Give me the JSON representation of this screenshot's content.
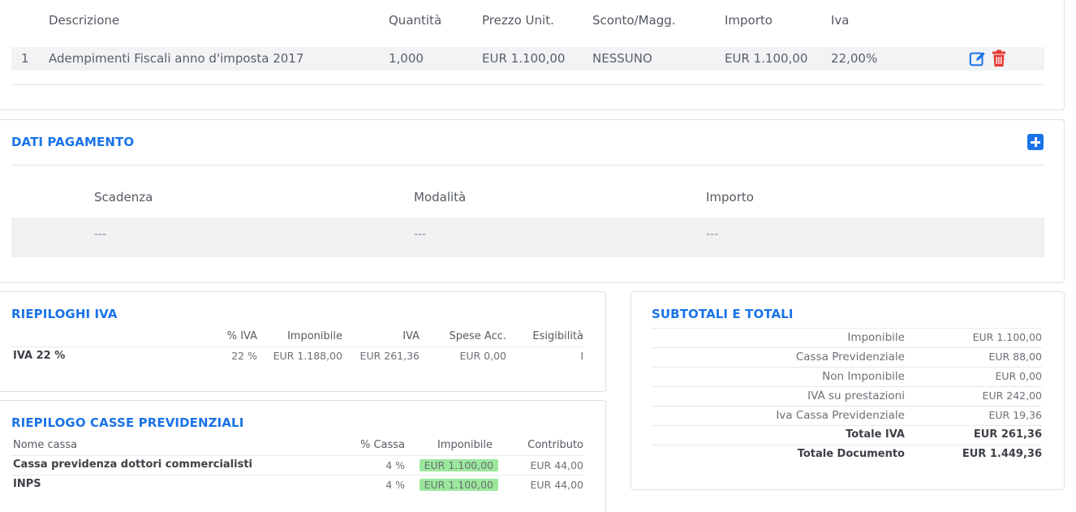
{
  "items": {
    "headers": {
      "descrizione": "Descrizione",
      "quantita": "Quantità",
      "prezzo": "Prezzo Unit.",
      "sconto": "Sconto/Magg.",
      "importo": "Importo",
      "iva": "Iva"
    },
    "rows": [
      {
        "n": "1",
        "descrizione": "Adempimenti Fiscali anno d'imposta 2017",
        "quantita": "1,000",
        "prezzo": "EUR 1.100,00",
        "sconto": "NESSUNO",
        "importo": "EUR 1.100,00",
        "iva": "22,00%"
      }
    ],
    "icons": {
      "edit": "edit-icon",
      "delete": "trash-icon"
    },
    "colors": {
      "edit": "#1a73e8",
      "delete": "#e53935"
    }
  },
  "payment": {
    "title": "DATI PAGAMENTO",
    "add_icon": "plus-square-icon",
    "headers": {
      "scadenza": "Scadenza",
      "modalita": "Modalità",
      "importo": "Importo"
    },
    "row": {
      "scadenza": "---",
      "modalita": "---",
      "importo": "---"
    }
  },
  "riepiloghi_iva": {
    "title": "RIEPILOGHI IVA",
    "headers": {
      "perc": "% IVA",
      "imponibile": "Imponibile",
      "iva": "IVA",
      "spese": "Spese Acc.",
      "esigibilita": "Esigibilità"
    },
    "rows": [
      {
        "label": "IVA 22 %",
        "perc": "22 %",
        "imponibile": "EUR 1.188,00",
        "iva": "EUR 261,36",
        "spese": "EUR 0,00",
        "esigibilita": "I"
      }
    ]
  },
  "casse": {
    "title": "RIEPILOGO CASSE PREVIDENZIALI",
    "headers": {
      "nome": "Nome cassa",
      "perc": "% Cassa",
      "imponibile": "Imponibile",
      "contributo": "Contributo"
    },
    "rows": [
      {
        "nome": "Cassa previdenza dottori commercialisti",
        "perc": "4 %",
        "imponibile": "EUR 1.100,00",
        "contributo": "EUR 44,00"
      },
      {
        "nome": "INPS",
        "perc": "4 %",
        "imponibile": "EUR 1.100,00",
        "contributo": "EUR 44,00"
      }
    ],
    "highlight_color": "#9be89c"
  },
  "totali": {
    "title": "SUBTOTALI E TOTALI",
    "rows": [
      {
        "label": "Imponibile",
        "value": "EUR 1.100,00"
      },
      {
        "label": "Cassa Previdenziale",
        "value": "EUR 88,00"
      },
      {
        "label": "Non Imponibile",
        "value": "EUR 0,00"
      },
      {
        "label": "IVA su prestazioni",
        "value": "EUR 242,00"
      },
      {
        "label": "Iva Cassa Previdenziale",
        "value": "EUR 19,36"
      },
      {
        "label": "Totale IVA",
        "value": "EUR 261,36"
      },
      {
        "label": "Totale Documento",
        "value": "EUR 1.449,36"
      }
    ]
  },
  "accent_color": "#1a73e8"
}
